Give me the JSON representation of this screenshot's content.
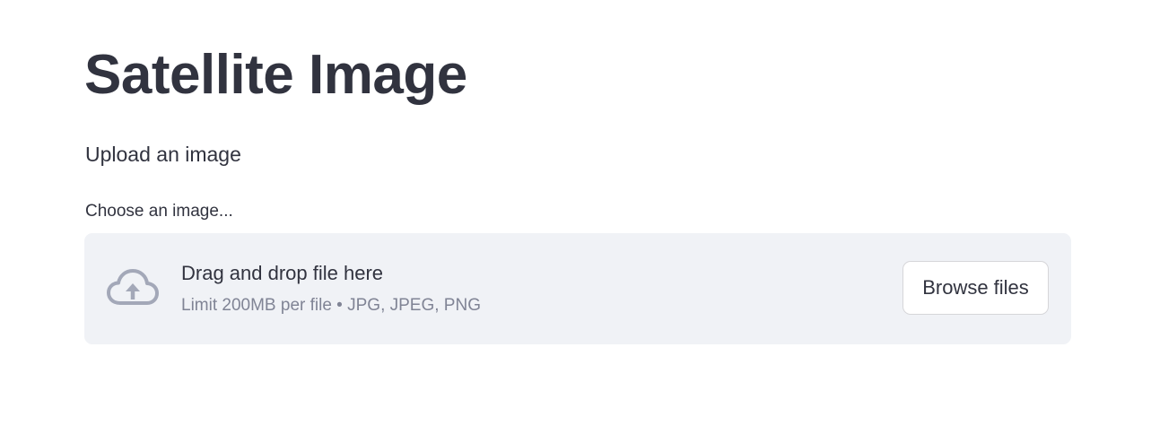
{
  "page": {
    "title": "Satellite Image",
    "subtitle": "Upload an image"
  },
  "uploader": {
    "label": "Choose an image...",
    "drop_text": "Drag and drop file here",
    "limit_text": "Limit 200MB per file • JPG, JPEG, PNG",
    "browse_label": "Browse files",
    "icon": "cloud-upload-icon"
  },
  "colors": {
    "text": "#31333f",
    "muted": "#808495",
    "dropzone_bg": "#f0f2f6",
    "icon": "#a3a8b8"
  }
}
